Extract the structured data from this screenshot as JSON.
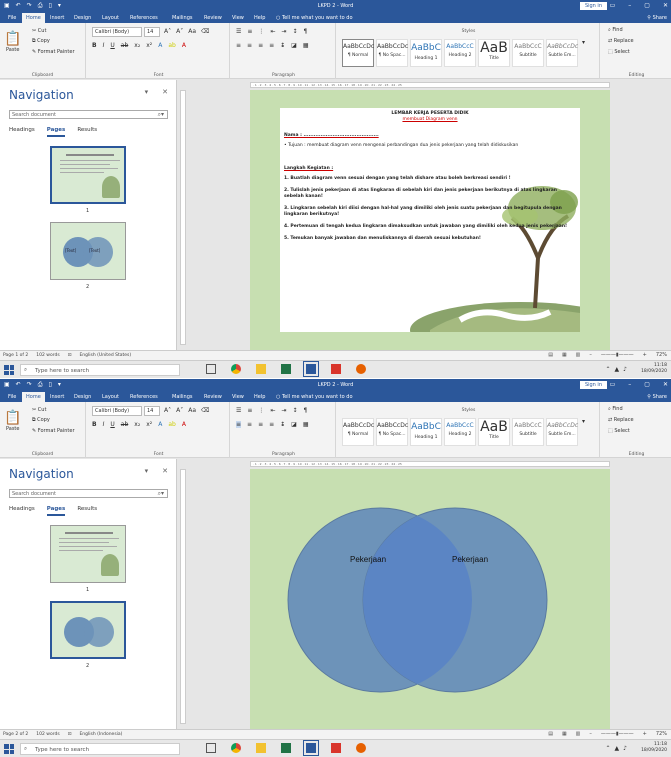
{
  "window": {
    "title": "LKPD 2 - Word",
    "signin": "Sign in",
    "share": "Share"
  },
  "tabs": [
    "File",
    "Home",
    "Insert",
    "Design",
    "Layout",
    "References",
    "Mailings",
    "Review",
    "View",
    "Help",
    "Tell me what you want to do"
  ],
  "clipboard": {
    "paste": "Paste",
    "cut": "Cut",
    "copy": "Copy",
    "format_painter": "Format Painter",
    "label": "Clipboard"
  },
  "font": {
    "name": "Calibri (Body)",
    "size": "14",
    "label": "Font"
  },
  "paragraph": {
    "label": "Paragraph"
  },
  "styles": {
    "label": "Styles",
    "items": [
      {
        "preview": "AaBbCcDc",
        "name": "¶ Normal"
      },
      {
        "preview": "AaBbCcDc",
        "name": "¶ No Spac..."
      },
      {
        "preview": "AaBbC",
        "name": "Heading 1"
      },
      {
        "preview": "AaBbCcC",
        "name": "Heading 2"
      },
      {
        "preview": "AaB",
        "name": "Title"
      },
      {
        "preview": "AaBbCcC",
        "name": "Subtitle"
      },
      {
        "preview": "AaBbCcDc",
        "name": "Subtle Em..."
      }
    ]
  },
  "editing": {
    "find": "Find",
    "replace": "Replace",
    "select": "Select",
    "label": "Editing"
  },
  "nav": {
    "title": "Navigation",
    "search_placeholder": "Search document",
    "tabs": [
      "Headings",
      "Pages",
      "Results"
    ],
    "page1": "1",
    "page2": "2"
  },
  "doc1": {
    "title": "LEMBAR KERJA PESERTA DIDIK",
    "subtitle": "membuat Diagram venn",
    "nama": "Nama : ............................................",
    "tujuan": "Tujuan : membuat diagram venn mengenai perbandingan dua jenis pekerjaan yang telah didiskusikan",
    "langkah": "Langkah Kegiatan :",
    "steps": [
      "1. Buatlah diagram venn sesuai dengan yang telah dishare atau boleh berkreasi sendiri !",
      "2. Tulislah jenis pekerjaan di atas lingkaran di sebelah kiri dan jenis pekerjaan berikutnya di atas lingkaran sebelah kanan!",
      "3. Lingkaran sebelah kiri diisi dengan hal-hal yang dimiliki oleh jenis suatu pekerjaan dan begitupula dengan lingkaran berikutnya!",
      "4. Pertemuan di tengah kedua lingkaran dimaksudkan untuk jawaban yang dimiliki oleh kedua jenis pekerjaan!",
      "5. Temukan banyak jawaban dan menuliskannya di daerah sesuai kebutuhan!"
    ]
  },
  "thumb_labels": {
    "left": "[Text]",
    "right": "[Text]"
  },
  "venn": {
    "left": "Pekerjaan",
    "right": "Pekerjaan",
    "fill": "#6d93b9",
    "overlap": "#5b85c4"
  },
  "status1": {
    "page": "Page 1 of 2",
    "words": "102 words",
    "lang": "English (United States)",
    "zoom": "72%"
  },
  "status2": {
    "page": "Page 2 of 2",
    "words": "102 words",
    "lang": "English (Indonesia)",
    "zoom": "72%"
  },
  "taskbar": {
    "search": "Type here to search",
    "time": "11:18",
    "date": "18/09/2020"
  },
  "colors": {
    "accent": "#2b579a",
    "page": "#c7dfb1"
  }
}
